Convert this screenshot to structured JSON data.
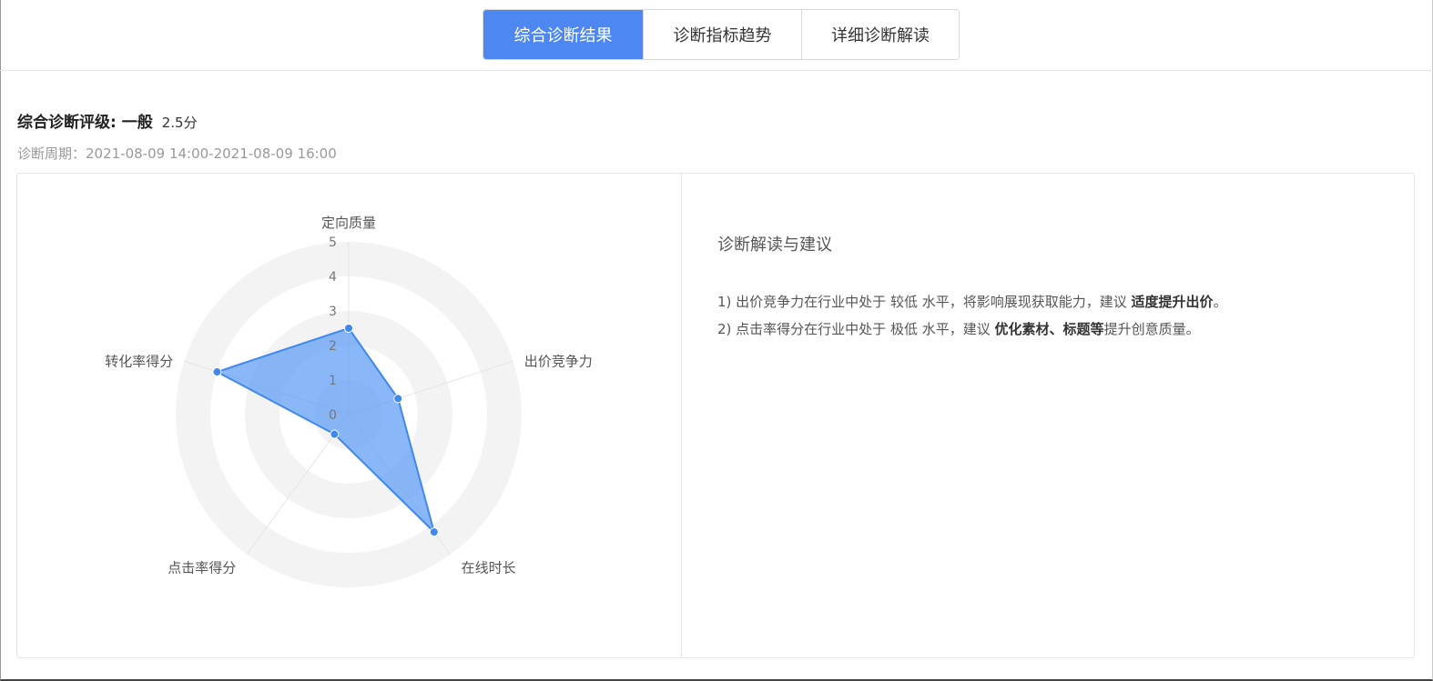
{
  "tabs": [
    {
      "label": "综合诊断结果",
      "active": true
    },
    {
      "label": "诊断指标趋势",
      "active": false
    },
    {
      "label": "详细诊断解读",
      "active": false
    }
  ],
  "summary": {
    "rating_label": "综合诊断评级: 一般",
    "score": "2.5分",
    "period": "诊断周期：2021-08-09 14:00-2021-08-09 16:00"
  },
  "advice": {
    "title": "诊断解读与建议",
    "item1": {
      "prefix": "1) 出价竞争力在行业中处于",
      "level": "较低",
      "middle": "水平，将影响展现获取能力，建议",
      "bold": "适度提升出价",
      "suffix": "。"
    },
    "item2": {
      "prefix": "2) 点击率得分在行业中处于",
      "level": "极低",
      "middle": "水平，建议",
      "bold": "优化素材、标题等",
      "suffix": "提升创意质量。"
    }
  },
  "chart_data": {
    "type": "radar",
    "indicators": [
      "定向质量",
      "出价竞争力",
      "在线时长",
      "点击率得分",
      "转化率得分"
    ],
    "values": [
      2.5,
      1.5,
      4.2,
      0.7,
      4.0
    ],
    "max": 5,
    "ticks": [
      "0",
      "1",
      "2",
      "3",
      "4",
      "5"
    ],
    "colors": {
      "fill": "#5b9bf5",
      "line": "#3f88ef",
      "ring_dark": "#f3f3f3",
      "ring_light": "#ffffff"
    }
  }
}
